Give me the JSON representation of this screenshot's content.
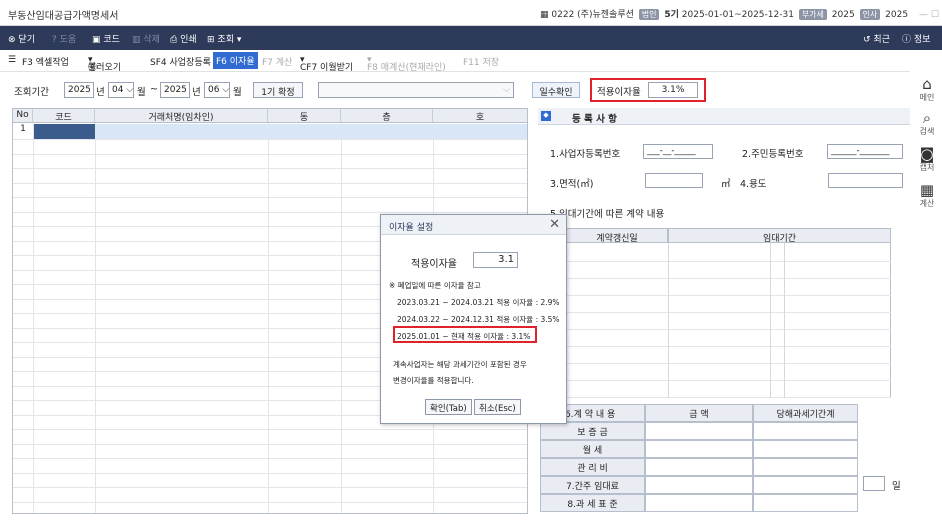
{
  "window": {
    "title": "부동산임대공급가액명세서",
    "company_code": "0222",
    "company_name": "(주)뉴젠솔루션",
    "corp_badge": "법인",
    "term": "5기",
    "period": "2025-01-01~2025-12-31",
    "vat_badge": "부가세",
    "vat_year": "2025",
    "tax_badge": "인사",
    "tax_year": "2025"
  },
  "toolbar1": {
    "close": "닫기",
    "help": "도움",
    "code": "코드",
    "delete": "삭제",
    "print": "인쇄",
    "query": "조회",
    "recent": "최근",
    "info": "정보"
  },
  "toolbar2": {
    "f3": "F3 엑셀작업",
    "load": "불러오기",
    "sf4": "SF4 사업장등록",
    "f6": "F6 이자율",
    "f7": "F7 계산",
    "cf7": "CF7 이월받기",
    "f8": "F8 매계산(현재라인)",
    "f11": "F11 저장"
  },
  "period": {
    "label": "조회기간",
    "from_year": "2025",
    "year_label": "년",
    "from_month": "04",
    "month_label": "월",
    "tilde": "~",
    "to_year": "2025",
    "to_month": "06",
    "term_confirm": "1기 확정",
    "days_check": "일수확인",
    "rate_label": "적용이자율",
    "rate_value": "3.1%"
  },
  "left_table": {
    "headers": [
      "No",
      "코드",
      "거래처명(임차인)",
      "동",
      "층",
      "호"
    ],
    "first_row_no": "1"
  },
  "right_panel": {
    "section_title": "등 록 사 항",
    "biz_reg_label": "1.사업자등록번호",
    "biz_reg_value": "___-__-_____",
    "resident_label": "2.주민등록번호",
    "resident_value": "______-_______",
    "area_label": "3.면적(㎡)",
    "area_unit": "㎡",
    "usage_label": "4.용도",
    "lease_content_label": "5.임대기간에 따른 계약 내용",
    "grid_headers": [
      "계약갱신일",
      "임대기간"
    ],
    "contract_label": "6.계 약 내 용",
    "amount_label": "금  액",
    "current_period_label": "당해과세기간계",
    "deposit": "보  증  금",
    "monthly_rent": "월     세",
    "maintenance": "관  리  비",
    "deemed_rent": "7.간주 임대료",
    "tax_base": "8.과 세 표 준",
    "day_unit": "일"
  },
  "dialog": {
    "title": "이자율 설정",
    "rate_label": "적용이자율",
    "rate_value": "3.1",
    "note_title": "※ 폐업일에 따른 이자율 참고",
    "line1": "2023.03.21 ~ 2024.03.21 적용 이자율 : 2.9%",
    "line2": "2024.03.22 ~ 2024.12.31 적용 이자율 : 3.5%",
    "line3": "2025.01.01 ~ 현재 적용 이자율 : 3.1%",
    "desc1": "계속사업자는 해당 과세기간이 포함된 경우",
    "desc2": "변경이자율를 적용합니다.",
    "ok": "확인(Tab)",
    "cancel": "취소(Esc)"
  },
  "sidebar": {
    "main": "메인",
    "search": "검색",
    "capture": "캡처",
    "calc": "계산"
  }
}
